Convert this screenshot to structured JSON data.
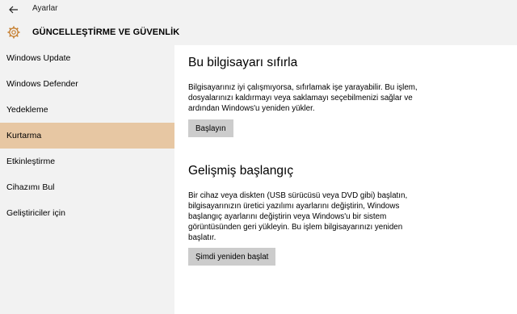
{
  "window": {
    "title": "Ayarlar",
    "back_icon": "back-arrow-icon"
  },
  "header": {
    "icon": "gear-icon",
    "title": "GÜNCELLEŞTİRME VE GÜVENLİK"
  },
  "sidebar": {
    "items": [
      {
        "label": "Windows Update",
        "active": false
      },
      {
        "label": "Windows Defender",
        "active": false
      },
      {
        "label": "Yedekleme",
        "active": false
      },
      {
        "label": "Kurtarma",
        "active": true
      },
      {
        "label": "Etkinleştirme",
        "active": false
      },
      {
        "label": "Cihazımı Bul",
        "active": false
      },
      {
        "label": "Geliştiriciler için",
        "active": false
      }
    ]
  },
  "colors": {
    "accent_selected": "#e7c7a3",
    "panel_bg": "#f2f2f2",
    "button_bg": "#cccccc"
  },
  "main": {
    "reset": {
      "heading": "Bu bilgisayarı sıfırla",
      "lines": [
        "Bilgisayarınız iyi çalışmıyorsa, sıfırlamak işe yarayabilir. Bu işlem,",
        "dosyalarınızı kaldırmayı veya saklamayı seçebilmenizi sağlar ve",
        "ardından Windows'u yeniden yükler."
      ],
      "button": "Başlayın"
    },
    "advanced": {
      "heading": "Gelişmiş başlangıç",
      "lines": [
        "Bir cihaz veya diskten (USB sürücüsü veya DVD gibi) başlatın,",
        "bilgisayarınızın üretici yazılımı ayarlarını değiştirin, Windows",
        "başlangıç ayarlarını değiştirin veya Windows'u bir sistem",
        "görüntüsünden geri yükleyin. Bu işlem bilgisayarınızı yeniden",
        "başlatır."
      ],
      "button": "Şimdi yeniden başlat"
    }
  }
}
